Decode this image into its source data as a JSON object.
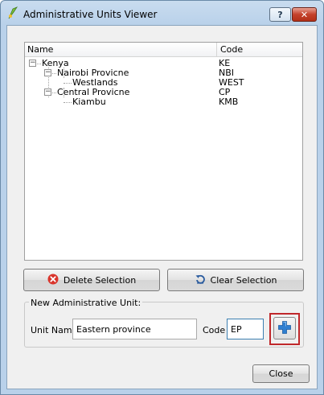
{
  "window": {
    "title": "Administrative Units Viewer",
    "help_label": "?",
    "close_label": "✕"
  },
  "tree": {
    "columns": [
      "Name",
      "Code"
    ],
    "rows": [
      {
        "name": "Kenya",
        "code": "KE",
        "level": 0,
        "expanded": true
      },
      {
        "name": "Nairobi Provicne",
        "code": "NBI",
        "level": 1,
        "expanded": true
      },
      {
        "name": "Westlands",
        "code": "WEST",
        "level": 2
      },
      {
        "name": "Central Provicne",
        "code": "CP",
        "level": 1,
        "expanded": true
      },
      {
        "name": "Kiambu",
        "code": "KMB",
        "level": 2
      }
    ]
  },
  "buttons": {
    "delete_label": "Delete Selection",
    "clear_label": "Clear Selection",
    "close_label": "Close"
  },
  "new_unit": {
    "group_title": "New Administrative Unit:",
    "unit_name_label": "Unit Name",
    "unit_name_value": "Eastern province",
    "code_label": "Code",
    "code_value": "EP"
  },
  "colors": {
    "delete_icon": "#d9342b",
    "add_icon": "#2f7fd0",
    "highlight": "#c0282b"
  },
  "icons": {
    "app": "qgis-icon",
    "delete": "delete-circle-icon",
    "clear": "undo-arrow-icon",
    "add": "plus-icon"
  }
}
